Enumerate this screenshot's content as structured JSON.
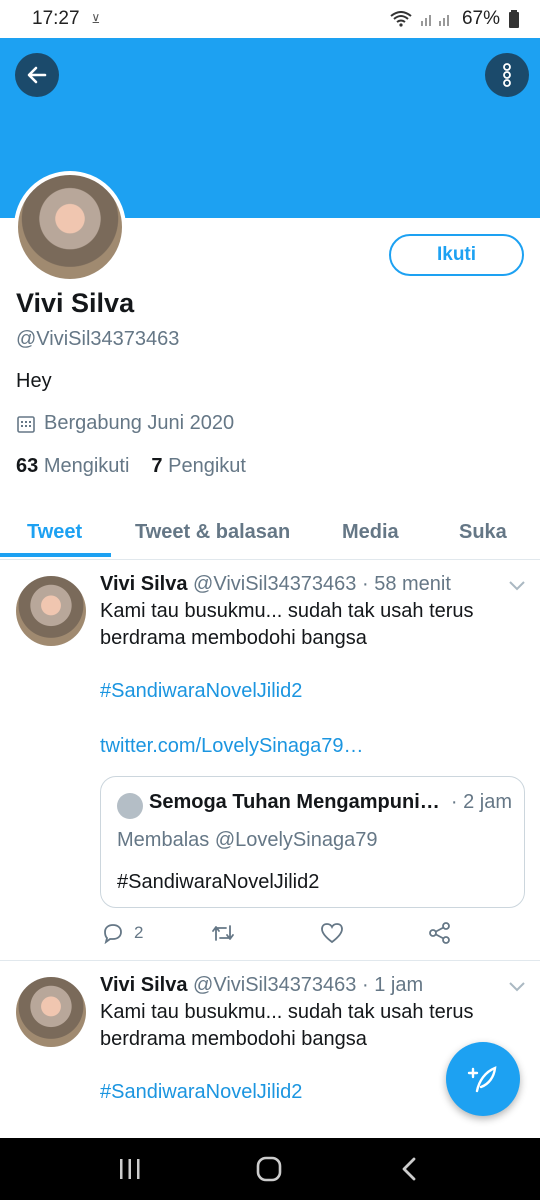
{
  "status_bar": {
    "time": "17:27",
    "notif": "",
    "battery": "67%"
  },
  "profile": {
    "name": "Vivi Silva",
    "handle": "@ViviSil34373463",
    "bio": "Hey",
    "joined": "Bergabung Juni 2020",
    "following_count": "63",
    "following_label": "Mengikuti",
    "followers_count": "7",
    "followers_label": "Pengikut",
    "follow_button": "Ikuti"
  },
  "tabs": [
    {
      "label": "Tweet",
      "active": true
    },
    {
      "label": "Tweet & balasan",
      "active": false
    },
    {
      "label": "Media",
      "active": false
    },
    {
      "label": "Suka",
      "active": false
    }
  ],
  "tweets": [
    {
      "name": "Vivi Silva",
      "meta": "@ViviSil34373463 · 58 menit",
      "text_line1": "Kami tau busukmu... sudah tak usah terus",
      "text_line2": "berdrama membodohi bangsa",
      "hashtag": "#SandiwaraNovelJilid2",
      "url": "twitter.com/LovelySinaga79…",
      "quote": {
        "name": "Semoga Tuhan Mengampuni…",
        "time": "· 2 jam",
        "replying": "Membalas @LovelySinaga79",
        "text": "#SandiwaraNovelJilid2"
      },
      "reply_count": "2"
    },
    {
      "name": "Vivi Silva",
      "meta": "@ViviSil34373463 · 1 jam",
      "text_line1": "Kami tau busukmu... sudah tak usah terus",
      "text_line2": "berdrama membodohi bangsa",
      "hashtag": "#SandiwaraNovelJilid2"
    }
  ],
  "colors": {
    "accent": "#1da1f2",
    "banner": "#1da1f2",
    "secondary_text": "#657786"
  }
}
